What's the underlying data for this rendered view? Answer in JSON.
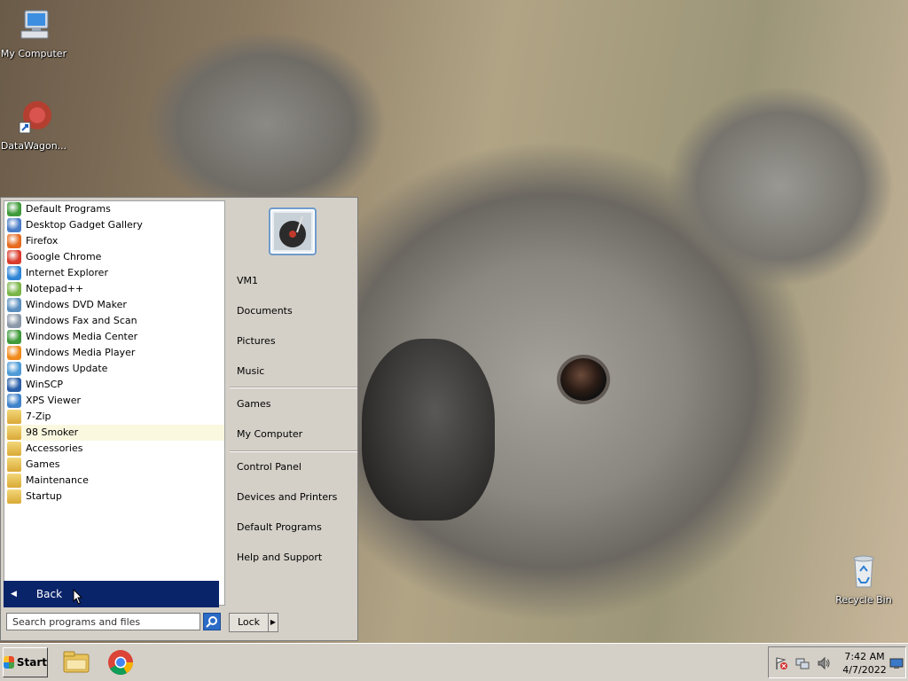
{
  "desktop": {
    "icons": [
      {
        "label": "My Computer"
      },
      {
        "label": "DataWagon..."
      },
      {
        "label": "Recycle Bin"
      }
    ]
  },
  "start_menu": {
    "programs": [
      {
        "label": "Default Programs",
        "icon": "default-programs-icon",
        "color": "#3f9a3a"
      },
      {
        "label": "Desktop Gadget Gallery",
        "icon": "gadget-icon",
        "color": "#4a7cc7"
      },
      {
        "label": "Firefox",
        "icon": "firefox-icon",
        "color": "#e66a1f"
      },
      {
        "label": "Google Chrome",
        "icon": "chrome-icon",
        "color": "#d93b2c"
      },
      {
        "label": "Internet Explorer",
        "icon": "ie-icon",
        "color": "#2f86d6"
      },
      {
        "label": "Notepad++",
        "icon": "notepadpp-icon",
        "color": "#7bb548"
      },
      {
        "label": "Windows DVD Maker",
        "icon": "dvd-maker-icon",
        "color": "#5b8fbf"
      },
      {
        "label": "Windows Fax and Scan",
        "icon": "fax-scan-icon",
        "color": "#8b98a8"
      },
      {
        "label": "Windows Media Center",
        "icon": "media-center-icon",
        "color": "#3f9a3a"
      },
      {
        "label": "Windows Media Player",
        "icon": "media-player-icon",
        "color": "#f08a1c"
      },
      {
        "label": "Windows Update",
        "icon": "windows-update-icon",
        "color": "#4c9ad6"
      },
      {
        "label": "WinSCP",
        "icon": "winscp-icon",
        "color": "#2a5fa8"
      },
      {
        "label": "XPS Viewer",
        "icon": "xps-viewer-icon",
        "color": "#3f82c9"
      },
      {
        "label": "7-Zip",
        "icon": "folder-icon",
        "color": "#e3b845"
      },
      {
        "label": "98 Smoker",
        "icon": "folder-icon",
        "color": "#e3b845"
      },
      {
        "label": "Accessories",
        "icon": "folder-icon",
        "color": "#e3b845"
      },
      {
        "label": "Games",
        "icon": "folder-icon",
        "color": "#e3b845"
      },
      {
        "label": "Maintenance",
        "icon": "folder-icon",
        "color": "#e3b845"
      },
      {
        "label": "Startup",
        "icon": "folder-icon",
        "color": "#e3b845"
      }
    ],
    "highlighted": "98 Smoker",
    "back_label": "Back",
    "search_placeholder": "Search programs and files",
    "places": {
      "user": "VM1",
      "documents": "Documents",
      "pictures": "Pictures",
      "music": "Music",
      "games": "Games",
      "my_computer": "My Computer",
      "control_panel": "Control Panel",
      "devices_printers": "Devices and Printers",
      "default_programs": "Default Programs",
      "help_support": "Help and Support"
    },
    "lock_label": "Lock"
  },
  "taskbar": {
    "start_label": "Start",
    "clock_time": "7:42 AM",
    "clock_date": "4/7/2022"
  },
  "colors": {
    "highlight_bar": "#0a246a",
    "menu_face": "#d4d0c8"
  }
}
